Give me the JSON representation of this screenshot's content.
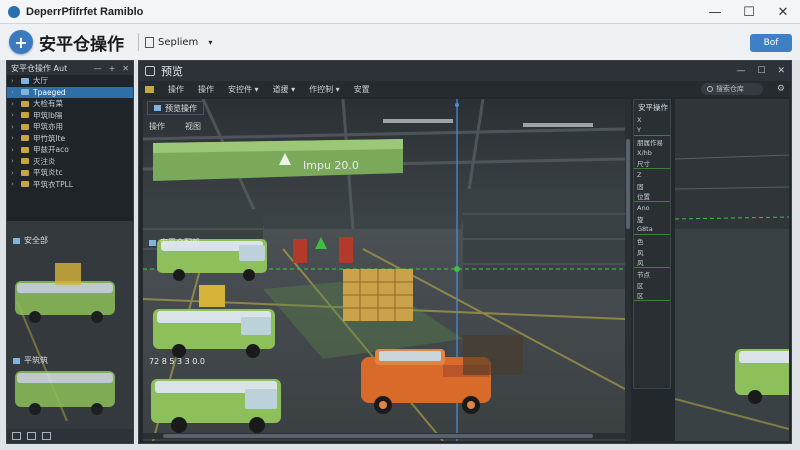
{
  "window": {
    "title": "DeperrPfifrfet Ramiblo",
    "controls": {
      "minimize": "—",
      "maximize": "☐",
      "close": "✕"
    }
  },
  "toolbar": {
    "app_title": "安平仓操作",
    "project_label": "Sepliem",
    "caret": "▾",
    "right_button": "Bof"
  },
  "left_panel": {
    "header": "安平仓操作 Aut",
    "header_tools": [
      "—",
      "+",
      "✕"
    ],
    "tree": [
      {
        "label": "大厅",
        "selected": false,
        "folder": "blue"
      },
      {
        "label": "Tpaeged",
        "selected": true,
        "folder": "blue"
      },
      {
        "label": "大检有菜",
        "selected": false,
        "folder": "yellow"
      },
      {
        "label": "甲筑lb隔",
        "selected": false,
        "folder": "yellow"
      },
      {
        "label": "甲筑亦用",
        "selected": false,
        "folder": "yellow"
      },
      {
        "label": "甲竹筑lte",
        "selected": false,
        "folder": "yellow"
      },
      {
        "label": "甲兹开aco",
        "selected": false,
        "folder": "yellow"
      },
      {
        "label": "灭注炎",
        "selected": false,
        "folder": "yellow"
      },
      {
        "label": "平筑炎tc",
        "selected": false,
        "folder": "yellow"
      },
      {
        "label": "平筑衣TPLL",
        "selected": false,
        "folder": "yellow"
      }
    ],
    "thumb_labels": [
      "安全部",
      "平筑筑"
    ]
  },
  "main_panel": {
    "title": "预览",
    "header_tools": [
      "—",
      "☐",
      "✕"
    ],
    "menu": [
      "操作",
      "操作",
      "安控件 ▾",
      "道援 ▾",
      "作控制 ▾",
      "安置"
    ],
    "search_placeholder": "搜索仓库",
    "gear": "⚙",
    "viewport_tab": "预览操作",
    "viewport_toolbar": [
      "操作",
      "视图"
    ],
    "scene_sign": "Impu 20.0",
    "vehicle_label_1": "安平仓配船",
    "vehicle_label_2": "72 8 5 3 3 0.0",
    "inspector_title": "安平操作",
    "inspector_props": [
      "X",
      "Y",
      "朋属作易",
      "X/hb",
      "尺寸",
      "Z",
      "固",
      "位置",
      "Ano",
      "旋",
      "G8ta",
      "色",
      "风",
      "风",
      "节点",
      "区",
      "区"
    ]
  },
  "colors": {
    "accent_blue": "#3f7fc4",
    "selection": "#2f6fa8",
    "guide_green": "#3fbf3f",
    "guide_blue": "#4c8fd8",
    "truck_green": "#8dbf5a",
    "truck_orange": "#d86a2a"
  }
}
